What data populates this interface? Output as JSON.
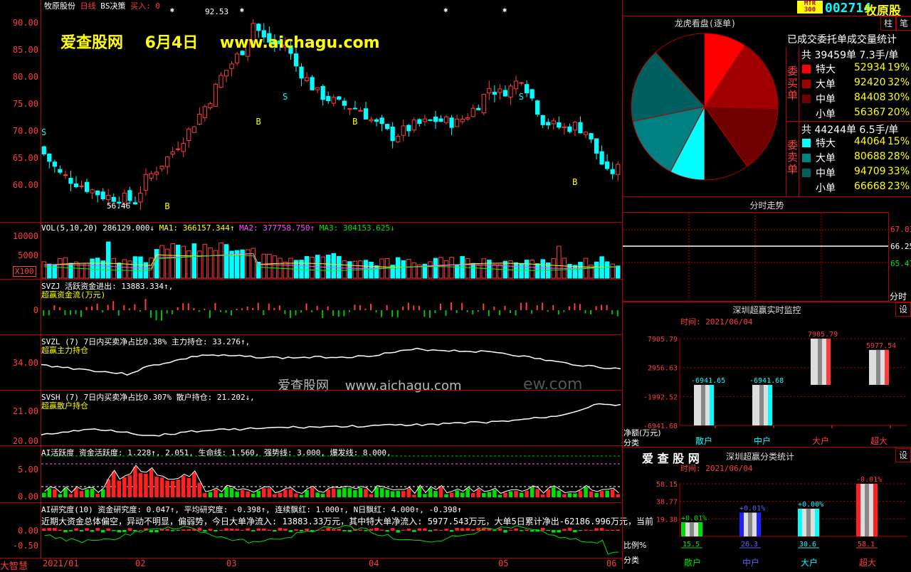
{
  "header": {
    "stock_name": "牧原股份",
    "period": "日线",
    "bs_label": "BS决策",
    "buy_label": "买入: 0",
    "high_mark": "92.53",
    "low_mark": "56.46",
    "watermark_top": "爱查股网    6月4日    www.aichagu.com",
    "watermark_mid": "爱查股网    www.aichagu.com",
    "watermark_mid_faded": "ew.com"
  },
  "price_axis": [
    "90.00",
    "85.00",
    "80.00",
    "75.00",
    "70.00",
    "65.00",
    "60.00"
  ],
  "signals": {
    "S": "S",
    "B": "B"
  },
  "vol_panel": {
    "title": "VOL(5,10,20) 286129.000↓",
    "ma1": "MA1: 366157.344↑",
    "ma2": "MA2: 377758.750↑",
    "ma3": "MA3: 304153.625↓",
    "axis": [
      "10000",
      "5000"
    ],
    "unit": "X100"
  },
  "svzj_panel": {
    "title": "SVZJ  活跃资金进出: 13883.334↑,",
    "subtitle": "超赢资金流(万元)",
    "axis": [
      "0"
    ]
  },
  "svzl_panel": {
    "title": "SVZL (7) 7日内买卖净占比0.38% 主力持仓: 33.276↑,",
    "subtitle": "超赢主力持仓",
    "axis": [
      "34.00"
    ]
  },
  "svsh_panel": {
    "title": "SVSH (7) 7日内买卖净占比0.307% 散户持仓: 21.202↓,",
    "subtitle": "超赢散户持仓",
    "axis": [
      "21.00",
      "20.00"
    ]
  },
  "ai_panel": {
    "title": "AI活跃度 资金活跃度: 1.228↑, 2.051, 生命线: 1.560, 强势线: 3.000, 爆发线: 8.000,",
    "axis": [
      "5.00",
      "0.00"
    ]
  },
  "ai_research": {
    "title": "AI研究度(10) 资金研究度: 0.047↑, 平均研究度: -0.398↑, 连续飘红: 1.000↑, N日飘红: 4.000↑, -0.398↑",
    "desc": "近期大资金总体偏空，异动不明显，偏弱势，今日大单净流入: 13883.33万元，其中特大单净流入: 5977.543万元，大单5日累计净出-62186.996万元，当前",
    "axis": [
      "0.00",
      "-0.50"
    ]
  },
  "corner_label": "大智慧",
  "date_axis": [
    "2021/01",
    "02",
    "03",
    "04",
    "05",
    "06"
  ],
  "right": {
    "badge": "MTR 300",
    "code": "002714",
    "name": "牧原股",
    "btn_zhu": "柱",
    "btn_bi": "笔",
    "lhb_title": "龙虎看盘(逐单)",
    "stat_title": "已成交委托单成交量统计",
    "buy_header": "共 39459单 7.3手/单",
    "buy_label": "委买单",
    "sell_header": "共 44244单 6.5手/单",
    "sell_label": "委卖单",
    "buy_rows": [
      {
        "label": "特大",
        "value": "52934",
        "pct": "19%",
        "color": "#ff0000"
      },
      {
        "label": "大单",
        "value": "92420",
        "pct": "32%",
        "color": "#a00000"
      },
      {
        "label": "中单",
        "value": "84408",
        "pct": "30%",
        "color": "#700000"
      },
      {
        "label": "小单",
        "value": "56367",
        "pct": "20%",
        "color": "#000000"
      }
    ],
    "sell_rows": [
      {
        "label": "特大",
        "value": "44064",
        "pct": "15%",
        "color": "#00ffff"
      },
      {
        "label": "大单",
        "value": "80688",
        "pct": "28%",
        "color": "#008080"
      },
      {
        "label": "中单",
        "value": "94709",
        "pct": "33%",
        "color": "#006060"
      },
      {
        "label": "小单",
        "value": "66668",
        "pct": "23%",
        "color": "#000000"
      }
    ],
    "fenshi_title": "分时走势",
    "fenshi_axis": [
      "67.03",
      "66.25",
      "65.47"
    ],
    "fenshi_unit": "分时",
    "monitor_title": "深圳超赢实时监控",
    "monitor_date": "时间: 2021/06/04",
    "monitor_btn": "设",
    "monitor_axis": [
      "7905.79",
      "2956.63",
      "-1992.52",
      "-6941.68"
    ],
    "monitor_unit": "净额(万元)",
    "monitor_cat": "分类",
    "class_title": "深圳超赢分类统计",
    "class_brand": "爱 查 股 网",
    "class_date": "时间: 2021/06/04",
    "class_btn": "设",
    "class_axis": [
      "58.15",
      "38.77",
      "19.38"
    ],
    "class_unit": "比例%",
    "class_cat": "分类"
  },
  "chart_data": [
    {
      "type": "bar",
      "title": "深圳超赢实时监控",
      "categories": [
        "散户",
        "中户",
        "大户",
        "超大"
      ],
      "values": [
        -6941.65,
        -6941.68,
        7905.79,
        5977.54
      ],
      "ylabel": "净额(万元)",
      "ylim": [
        -6941.68,
        7905.79
      ]
    },
    {
      "type": "bar",
      "title": "深圳超赢分类统计",
      "categories": [
        "散户",
        "中户",
        "大户",
        "超大"
      ],
      "values": [
        15.5,
        26.3,
        30.6,
        58.1
      ],
      "labels": [
        "+0.01%",
        "+0.01%",
        "+0.00%",
        "-0.01%"
      ],
      "ylabel": "比例%",
      "ylim": [
        0,
        58.15
      ]
    },
    {
      "type": "pie",
      "title": "龙虎看盘(逐单)",
      "categories": [
        "买特大",
        "买大单",
        "买中单",
        "买小单",
        "卖特大",
        "卖大单",
        "卖中单",
        "卖小单"
      ],
      "values": [
        52934,
        92420,
        84408,
        56367,
        44064,
        80688,
        94709,
        66668
      ]
    }
  ]
}
